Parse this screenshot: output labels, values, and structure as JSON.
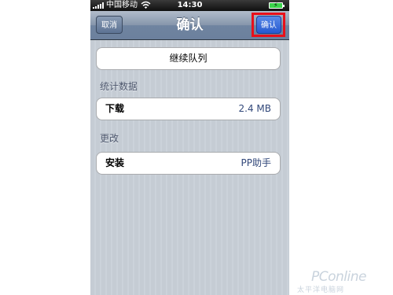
{
  "status_bar": {
    "carrier": "中国移动",
    "time": "14:30"
  },
  "nav": {
    "title": "确认",
    "cancel_label": "取消",
    "confirm_label": "确认"
  },
  "queue_button_label": "继续队列",
  "sections": {
    "stats": {
      "header": "统计数据",
      "row_label": "下载",
      "row_value": "2.4 MB"
    },
    "changes": {
      "header": "更改",
      "row_label": "安装",
      "row_value": "PP助手"
    }
  },
  "watermark": {
    "logo": "PConline",
    "tagline": "太平洋电脑网"
  },
  "colors": {
    "highlight_box": "#e8101a",
    "confirm_button": "#2559d0",
    "navbar": "#6f84a0"
  }
}
